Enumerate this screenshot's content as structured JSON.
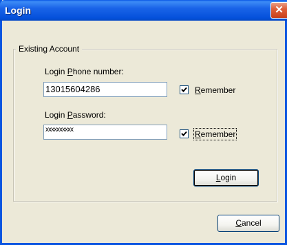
{
  "window": {
    "title": "Login",
    "close_glyph": "✕"
  },
  "group": {
    "legend": "Existing Account"
  },
  "phone": {
    "label_pre": "Login ",
    "label_mnemonic": "P",
    "label_post": "hone number:",
    "value": "13015604286",
    "remember_checked": true,
    "remember_mnemonic": "R",
    "remember_rest": "emember"
  },
  "password": {
    "label_pre": "Login ",
    "label_mnemonic": "P",
    "label_post": "assword:",
    "value": "xxxxxxxxxx",
    "remember_checked": true,
    "remember_mnemonic": "R",
    "remember_rest": "emember"
  },
  "buttons": {
    "login_mnemonic": "L",
    "login_rest": "ogin",
    "cancel_mnemonic": "C",
    "cancel_rest": "ancel"
  },
  "icons": {
    "close": "close-icon",
    "check": "checkmark-icon"
  }
}
